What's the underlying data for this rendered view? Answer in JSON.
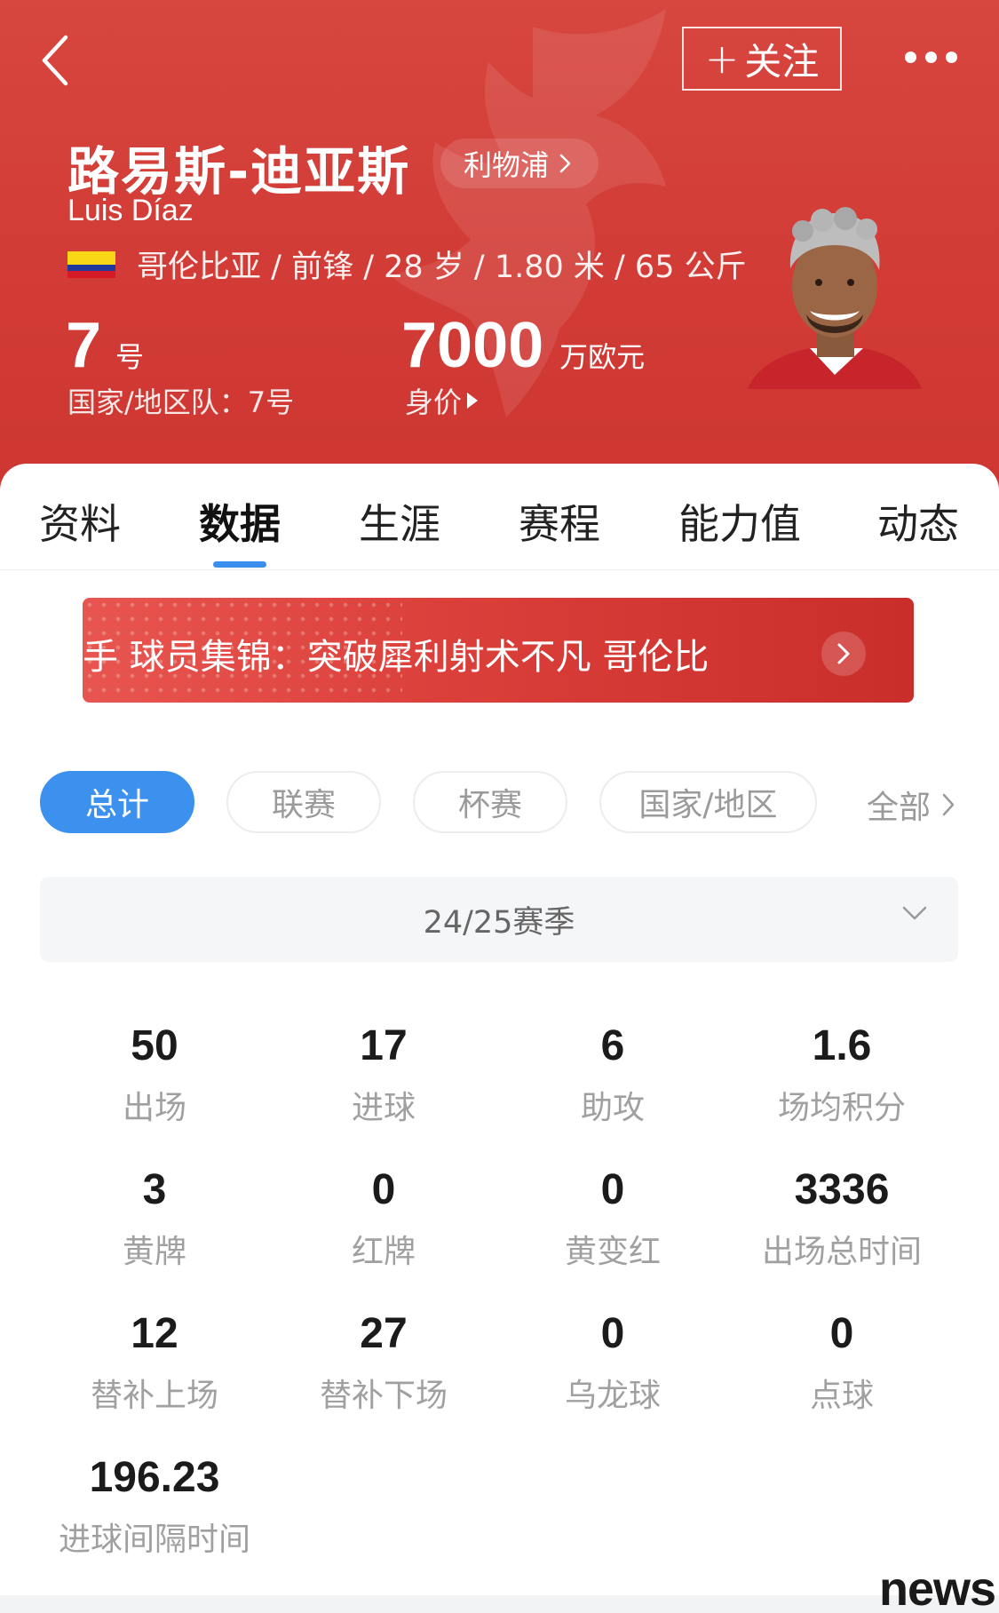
{
  "header": {
    "follow_label": "关注",
    "player_name_cn": "路易斯-迪亚斯",
    "player_name_en": "Luis Díaz",
    "club": "利物浦",
    "country": "哥伦比亚",
    "info_rest": "/ 前锋 / 28 岁 / 1.80 米 / 65 公斤",
    "shirt_number": "7",
    "shirt_unit": "号",
    "national_number": "国家/地区队：7号",
    "market_value": "7000",
    "market_value_unit": "万欧元",
    "market_value_label": "身价"
  },
  "tabs": [
    {
      "label": "资料"
    },
    {
      "label": "数据"
    },
    {
      "label": "生涯"
    },
    {
      "label": "赛程"
    },
    {
      "label": "能力值"
    },
    {
      "label": "动态"
    }
  ],
  "active_tab": "数据",
  "banner": {
    "text": "手    球员集锦：突破犀利射术不凡 哥伦比"
  },
  "filters": {
    "chips": [
      "总计",
      "联赛",
      "杯赛",
      "国家/地区"
    ],
    "all_label": "全部",
    "active": "总计"
  },
  "season": {
    "selected": "24/25赛季"
  },
  "stats": [
    {
      "value": "50",
      "label": "出场"
    },
    {
      "value": "17",
      "label": "进球"
    },
    {
      "value": "6",
      "label": "助攻"
    },
    {
      "value": "1.6",
      "label": "场均积分"
    },
    {
      "value": "3",
      "label": "黄牌"
    },
    {
      "value": "0",
      "label": "红牌"
    },
    {
      "value": "0",
      "label": "黄变红"
    },
    {
      "value": "3336",
      "label": "出场总时间"
    },
    {
      "value": "12",
      "label": "替补上场"
    },
    {
      "value": "27",
      "label": "替补下场"
    },
    {
      "value": "0",
      "label": "乌龙球"
    },
    {
      "value": "0",
      "label": "点球"
    },
    {
      "value": "196.23",
      "label": "进球间隔时间"
    }
  ],
  "watermark_text": "news",
  "colors": {
    "header_red": "#d23b36",
    "accent_blue": "#3d91ee",
    "tab_indicator": "#3a8eee"
  },
  "icons": [
    "back-arrow-icon",
    "more-dots-icon",
    "chevron-right-icon",
    "chevron-down-icon",
    "colombia-flag-icon",
    "liverbird-watermark-icon"
  ]
}
